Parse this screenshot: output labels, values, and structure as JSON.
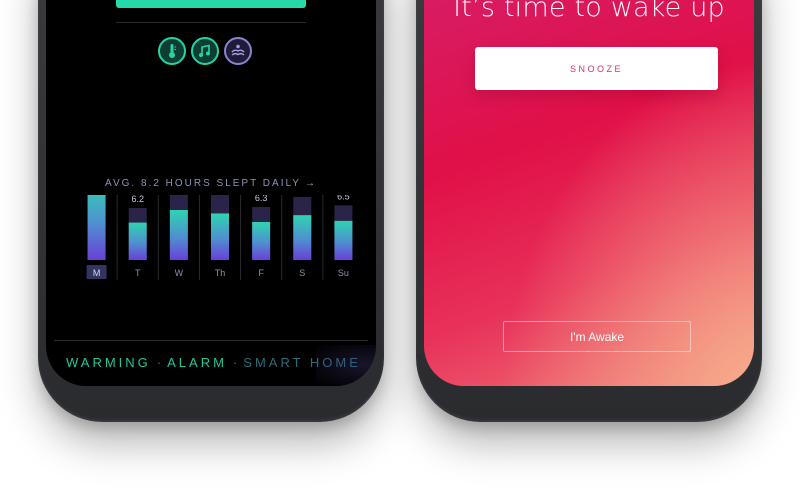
{
  "left_screen": {
    "icons": [
      {
        "name": "thermometer-icon",
        "style": "teal"
      },
      {
        "name": "music-note-icon",
        "style": "teal"
      },
      {
        "name": "meditation-icon",
        "style": "purple"
      }
    ],
    "avg_text": "AVG. 8.2 HOURS SLEPT DAILY",
    "avg_arrow": "→",
    "chart_data": {
      "type": "bar",
      "categories": [
        "M",
        "T",
        "W",
        "Th",
        "F",
        "S",
        "Su"
      ],
      "values": [
        9.5,
        6.2,
        8.4,
        7.8,
        6.3,
        7.5,
        6.5
      ],
      "ylim": [
        0,
        10
      ],
      "selected": "M",
      "colors": {
        "top": "#2fd3b0",
        "bottom": "#6a3fd6",
        "track": "#2a2448",
        "label": "#c8c8d8",
        "day_label": "#8d8fa8",
        "selected_bg": "#5f5fb0"
      }
    },
    "nav": {
      "warming": "WARMING",
      "sep1": "·",
      "alarm": "ALARM",
      "sep2": "·",
      "smart_home": "SMART HOME"
    }
  },
  "right_screen": {
    "title": "It’s time to wake up",
    "snooze_label": "SNOOZE",
    "awake_label": "I'm Awake"
  }
}
